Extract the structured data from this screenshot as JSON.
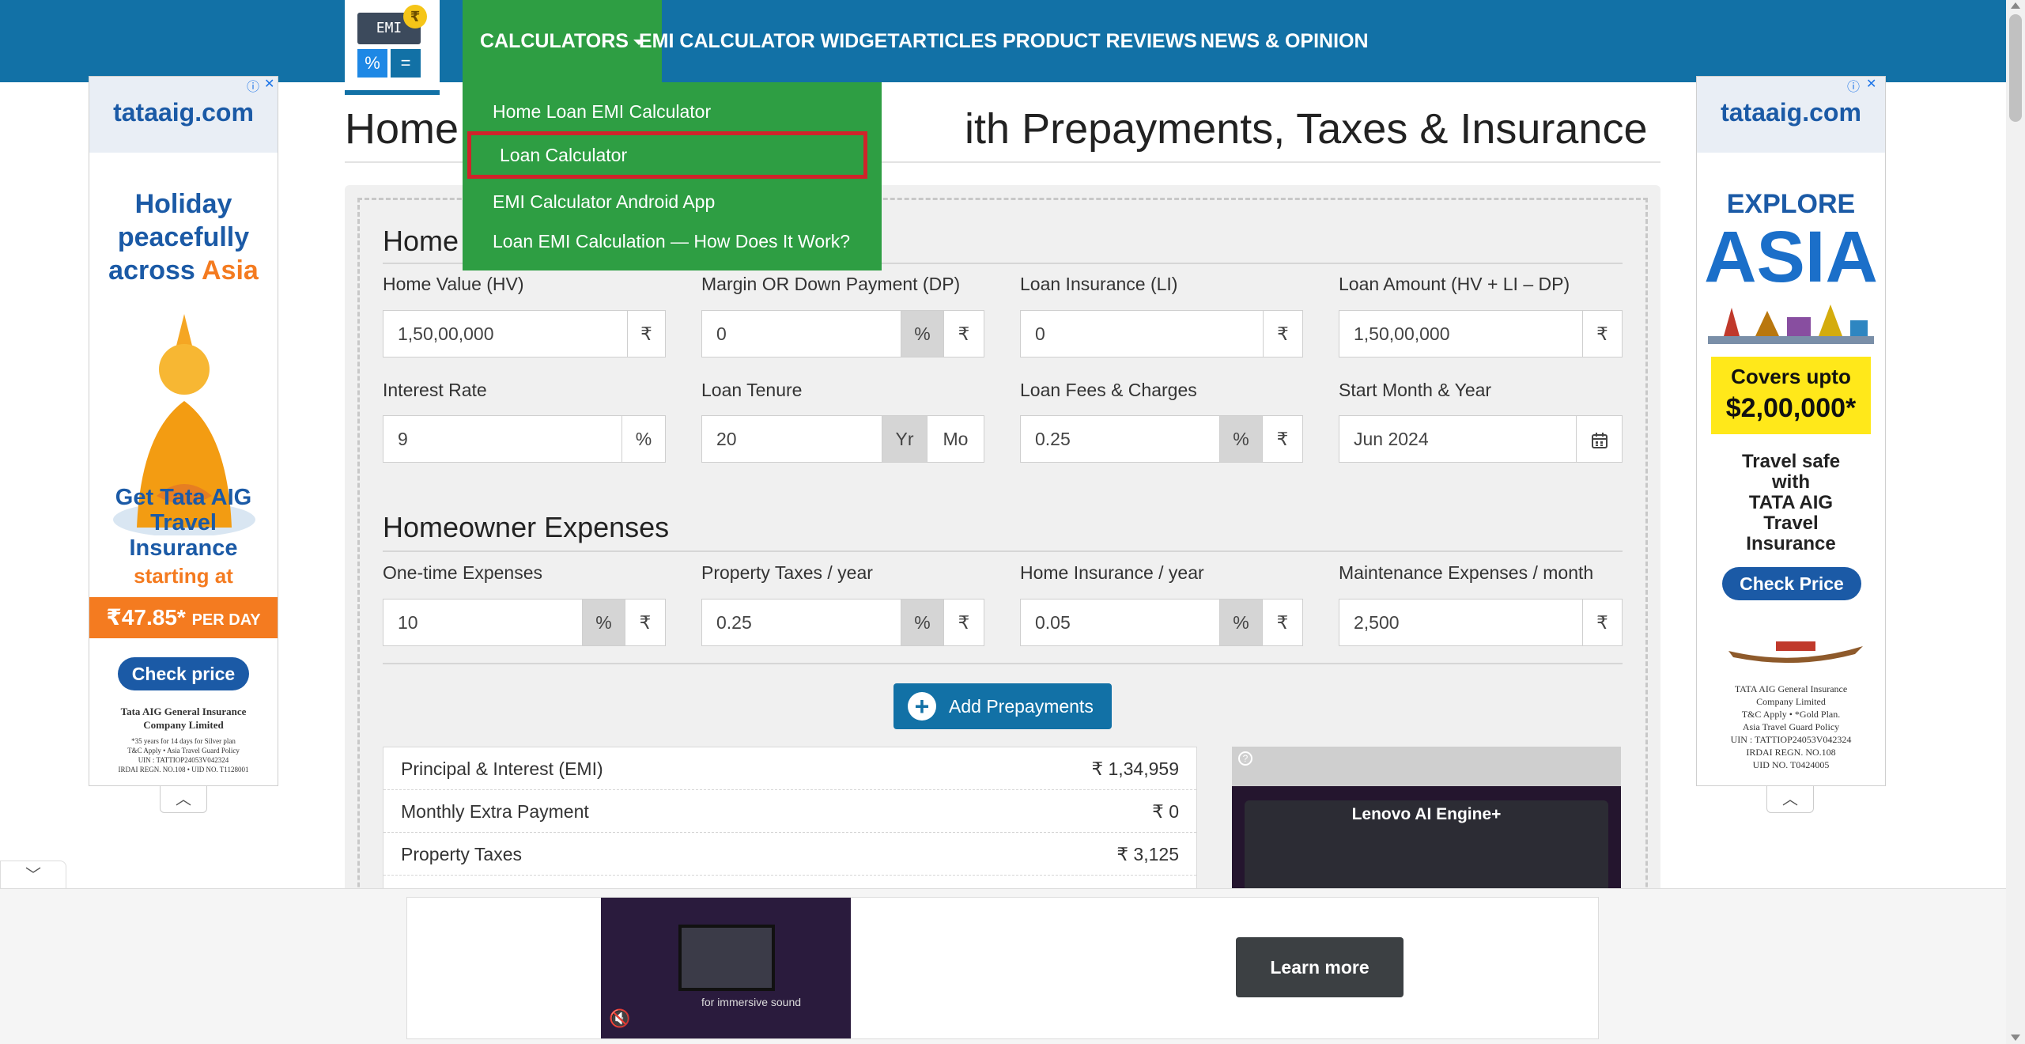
{
  "brand": {
    "logo_text": "EMI",
    "logo_rupee": "₹",
    "logo_percent": "%",
    "logo_equals": "="
  },
  "nav": {
    "items": [
      {
        "label": "CALCULATORS"
      },
      {
        "label": "EMI CALCULATOR WIDGET"
      },
      {
        "label": "ARTICLES"
      },
      {
        "label": "PRODUCT REVIEWS"
      },
      {
        "label": "NEWS & OPINION"
      }
    ],
    "dropdown": [
      "Home Loan EMI Calculator",
      "Loan Calculator",
      "EMI Calculator Android App",
      "Loan EMI Calculation — How Does It Work?"
    ],
    "highlighted_item": "Loan Calculator"
  },
  "page": {
    "title_left": "Home",
    "title_right": "ith Prepayments, Taxes & Insurance"
  },
  "loan_section": {
    "title": "Home",
    "fields": [
      {
        "label": "Home Value (HV)",
        "value": "1,50,00,000",
        "addons": [
          "₹"
        ]
      },
      {
        "label": "Margin OR Down Payment (DP)",
        "value": "0",
        "addons": [
          "%",
          "₹"
        ]
      },
      {
        "label": "Loan Insurance (LI)",
        "value": "0",
        "addons": [
          "₹"
        ]
      },
      {
        "label": "Loan Amount (HV + LI – DP)",
        "value": "1,50,00,000",
        "addons": [
          "₹"
        ]
      },
      {
        "label": "Interest Rate",
        "value": "9",
        "addons": [
          "%"
        ]
      },
      {
        "label": "Loan Tenure",
        "value": "20",
        "addons": [
          "Yr",
          "Mo"
        ]
      },
      {
        "label": "Loan Fees & Charges",
        "value": "0.25",
        "addons": [
          "%",
          "₹"
        ]
      },
      {
        "label": "Start Month & Year",
        "value": "Jun 2024",
        "addons": [
          "calendar-icon"
        ]
      }
    ]
  },
  "expenses_section": {
    "title": "Homeowner Expenses",
    "fields": [
      {
        "label": "One-time Expenses",
        "value": "10",
        "addons": [
          "%",
          "₹"
        ]
      },
      {
        "label": "Property Taxes / year",
        "value": "0.25",
        "addons": [
          "%",
          "₹"
        ]
      },
      {
        "label": "Home Insurance / year",
        "value": "0.05",
        "addons": [
          "%",
          "₹"
        ]
      },
      {
        "label": "Maintenance Expenses / month",
        "value": "2,500",
        "addons": [
          "₹"
        ]
      }
    ]
  },
  "add_prepayments": {
    "label": "Add Prepayments"
  },
  "summary": [
    {
      "label": "Principal & Interest (EMI)",
      "value": "₹ 1,34,959"
    },
    {
      "label": "Monthly Extra Payment",
      "value": "₹ 0"
    },
    {
      "label": "Property Taxes",
      "value": "₹ 3,125"
    }
  ],
  "video_ad": {
    "title": "Lenovo AI Engine+"
  },
  "left_ad": {
    "brand": "tataaig.com",
    "headline": [
      "Holiday",
      "peacefully",
      "across"
    ],
    "headline_accent": "Asia",
    "sub": [
      "Get Tata AIG",
      "Travel",
      "Insurance"
    ],
    "starting_at": "starting at",
    "price": "₹47.85*",
    "per_day": "PER DAY",
    "cta": "Check price",
    "company": [
      "Tata AIG General Insurance",
      "Company Limited"
    ],
    "fine": [
      "*35 years for 14 days for Silver plan",
      "T&C Apply • Asia Travel Guard Policy",
      "UIN : TATTIOP24053V042324",
      "IRDAI REGN. NO.108 • UID NO. T1128001"
    ]
  },
  "right_ad": {
    "brand": "tataaig.com",
    "explore": "EXPLORE",
    "region": "ASIA",
    "covers": [
      "Covers upto",
      "$2,00,000*"
    ],
    "tagline": [
      "Travel safe",
      "with",
      "TATA AIG",
      "Travel",
      "Insurance"
    ],
    "cta": "Check Price",
    "fine": [
      "TATA AIG General Insurance",
      "Company Limited",
      "T&C Apply • *Gold Plan.",
      "Asia Travel Guard Policy",
      "UIN : TATTIOP24053V042324",
      "IRDAI REGN. NO.108",
      "UID NO. T0424005"
    ]
  },
  "bottom_ad": {
    "cta": "Learn more",
    "caption": "for immersive sound"
  },
  "colors": {
    "nav": "#1271a6",
    "dropdown": "#2e9e43",
    "highlight_border": "#d0232a",
    "card": "#f0f0f0"
  }
}
